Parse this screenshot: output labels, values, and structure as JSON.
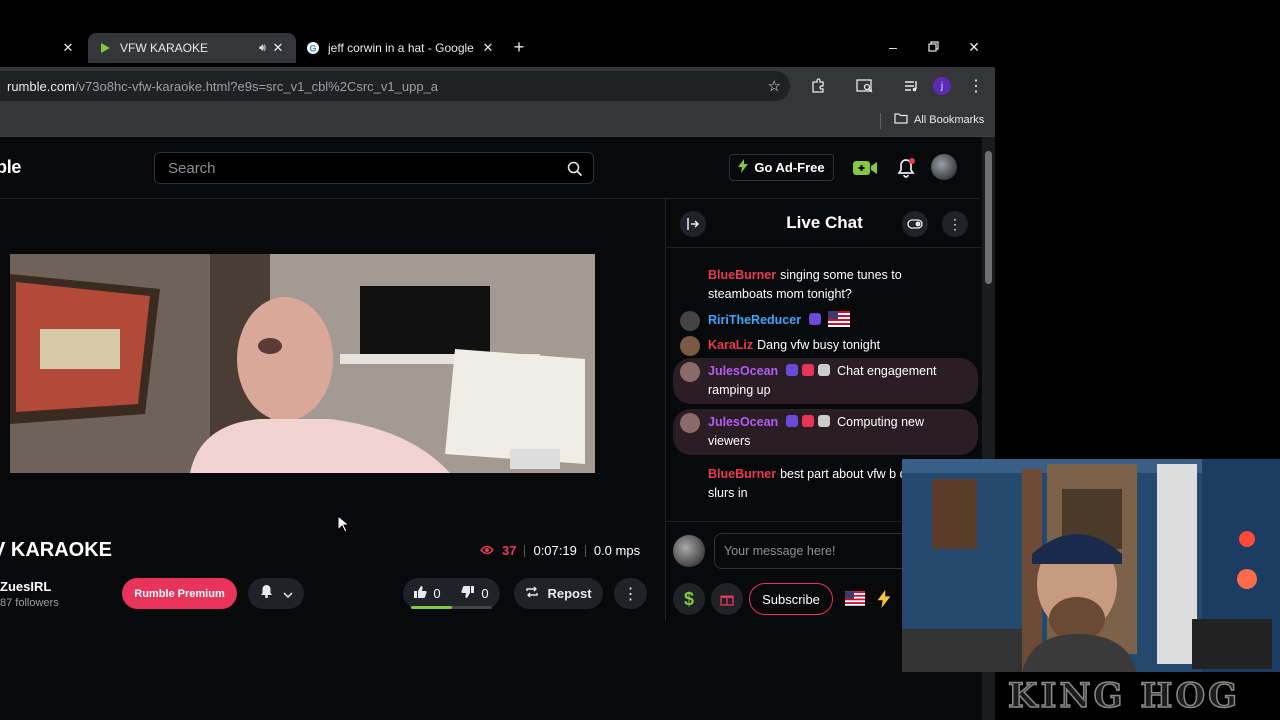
{
  "browser": {
    "tabs": [
      {
        "title": "",
        "active": false
      },
      {
        "title": "VFW KARAOKE",
        "active": true,
        "audio": true
      },
      {
        "title": "jeff corwin in a hat - Google Se",
        "active": false
      }
    ],
    "url_host": "rumble.com",
    "url_path": "/v73o8hc-vfw-karaoke.html?e9s=src_v1_cbl%2Csrc_v1_upp_a",
    "bookmarks_label": "All Bookmarks",
    "profile_initial": "j"
  },
  "site": {
    "logo": "ble",
    "search_placeholder": "Search",
    "ad_free_label": "Go Ad-Free"
  },
  "video": {
    "title": "V KARAOKE",
    "viewers": "37",
    "duration": "0:07:19",
    "bitrate": "0.0 mps",
    "channel": "ZuesIRL",
    "followers": "87 followers",
    "premium_label": "Rumble Premium",
    "likes": "0",
    "dislikes": "0",
    "repost_label": "Repost"
  },
  "chat": {
    "title": "Live Chat",
    "input_placeholder": "Your message here!",
    "subscribe_label": "Subscribe",
    "messages": [
      {
        "user": "BlueBurner",
        "color": "#ea3a52",
        "text": "singing some tunes to steamboats mom tonight?",
        "highlight": false
      },
      {
        "user": "RiriTheReducer",
        "color": "#3ea6ff",
        "text": "",
        "highlight": false
      },
      {
        "user": "KaraLiz",
        "color": "#ea3a52",
        "text": "Dang vfw busy tonight",
        "highlight": false
      },
      {
        "user": "JulesOcean",
        "color": "#b45cf5",
        "text": "Chat engagement ramping up",
        "highlight": true
      },
      {
        "user": "JulesOcean",
        "color": "#b45cf5",
        "text": "Computing new viewers",
        "highlight": true
      },
      {
        "user": "BlueBurner",
        "color": "#ea3a52",
        "text": "best part about vfw b dont allow f slurs in",
        "highlight": false
      }
    ]
  },
  "overlay": {
    "watermark": "KING HOG"
  }
}
